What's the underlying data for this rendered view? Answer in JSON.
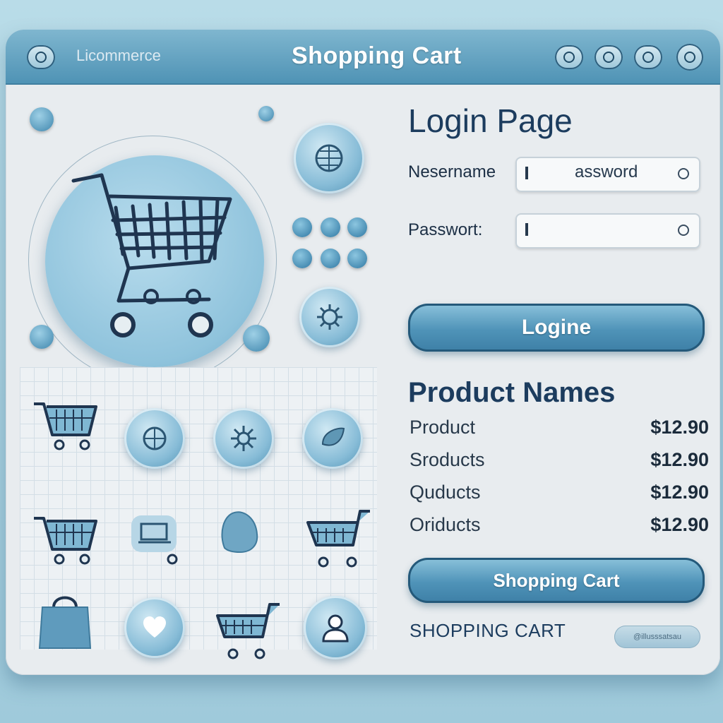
{
  "titlebar": {
    "brand": "Licommerce",
    "title": "Shopping Cart"
  },
  "login": {
    "title": "Login Page",
    "username_label": "Nesername",
    "username_value": "assword",
    "password_label": "Passwort:",
    "password_value": "",
    "login_button": "Logine"
  },
  "products": {
    "title": "Product Names",
    "items": [
      {
        "name": "Product",
        "price": "$12.90"
      },
      {
        "name": "Sroducts",
        "price": "$12.90"
      },
      {
        "name": "Quducts",
        "price": "$12.90"
      },
      {
        "name": "Oriducts",
        "price": "$12.90"
      }
    ]
  },
  "cart_button": "Shopping Cart",
  "footer": {
    "label": "SHOPPING CART",
    "chip": "@illusssatsau"
  },
  "icons": {
    "hero": "shopping-cart-icon",
    "grid": [
      "shopping-cart-icon",
      "globe-icon",
      "gear-icon",
      "leaf-icon",
      "shopping-cart-icon",
      "laptop-icon",
      "glove-icon",
      "shopping-cart-icon",
      "shopping-bag-icon",
      "heart-icon",
      "shopping-cart-icon",
      "user-icon"
    ]
  },
  "colors": {
    "accent": "#4f93b5",
    "accent_dark": "#24597a",
    "background": "#e8ecef",
    "text": "#1c3c5e"
  }
}
